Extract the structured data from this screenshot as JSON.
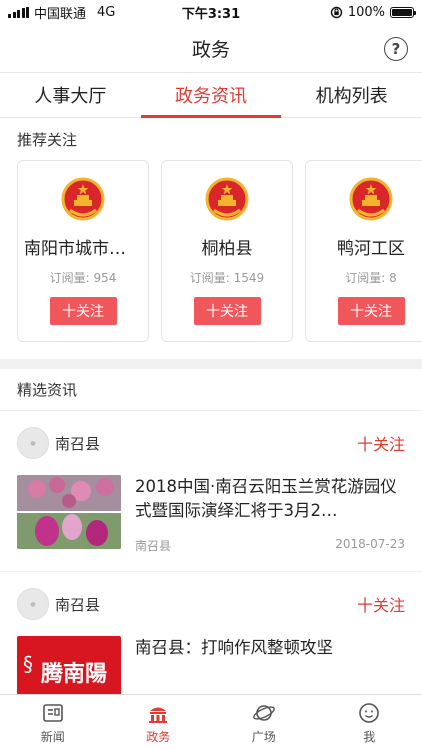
{
  "status_bar": {
    "carrier": "中国联通",
    "network": "4G",
    "time": "下午3:31",
    "battery_percent": "100%",
    "battery_level": 1.0
  },
  "nav": {
    "title": "政务",
    "help_glyph": "?"
  },
  "tabs": [
    {
      "label": "人事大厅",
      "active": false
    },
    {
      "label": "政务资讯",
      "active": true
    },
    {
      "label": "机构列表",
      "active": false
    }
  ],
  "recommend": {
    "section_title": "推荐关注",
    "cards": [
      {
        "name": "南阳市城市管理局",
        "subs": "订阅量: 954",
        "follow": "十关注"
      },
      {
        "name": "桐柏县",
        "subs": "订阅量: 1549",
        "follow": "十关注"
      },
      {
        "name": "鸭河工区",
        "subs": "订阅量: 8",
        "follow": "十关注"
      }
    ]
  },
  "feed": {
    "section_title": "精选资讯",
    "items": [
      {
        "source": "南召县",
        "follow": "十关注",
        "title": "2018中国·南召云阳玉兰赏花游园仪式暨国际演绎汇将于3月2…",
        "meta_source": "南召县",
        "date": "2018-07-23",
        "thumb": "magnolia-photo"
      },
      {
        "source": "南召县",
        "follow": "十关注",
        "title": "南召县：打响作风整顿攻坚",
        "thumb": "tengnanyang-logo",
        "logo_text": "腾南陽"
      }
    ]
  },
  "tabbar": [
    {
      "label": "新闻",
      "icon": "news-icon",
      "active": false
    },
    {
      "label": "政务",
      "icon": "government-icon",
      "active": true
    },
    {
      "label": "广场",
      "icon": "planet-icon",
      "active": false
    },
    {
      "label": "我",
      "icon": "profile-icon",
      "active": false
    }
  ],
  "colors": {
    "accent": "#e23b32",
    "follow_button": "#f0575a"
  }
}
